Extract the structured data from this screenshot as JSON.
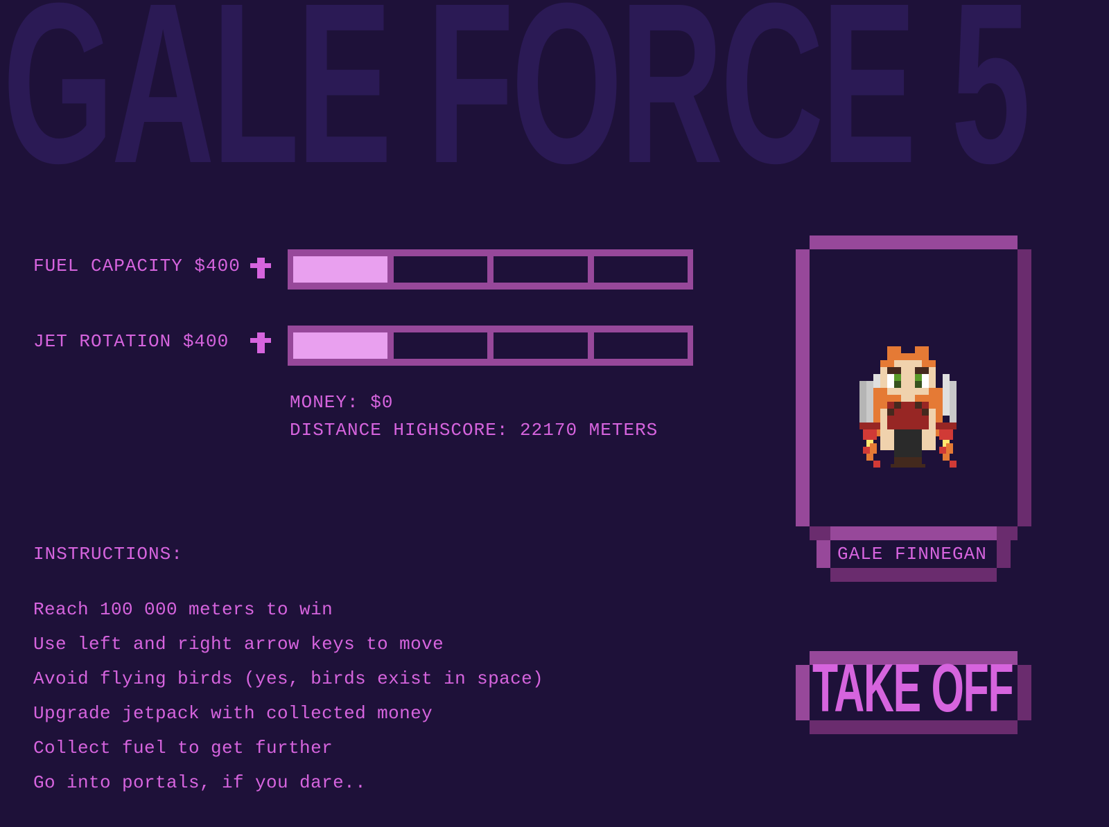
{
  "game": {
    "title": "GALE FORCE 5"
  },
  "colors": {
    "background": "#1e1139",
    "title_text": "#2b1a55",
    "text": "#d664de",
    "frame_light": "#97489a",
    "frame_dark": "#6a2c6e",
    "bar_filled": "#e9a0ef"
  },
  "upgrades": [
    {
      "label": "FUEL CAPACITY $400",
      "icon": "plus-icon",
      "level": 1,
      "max_level": 4
    },
    {
      "label": "JET ROTATION $400",
      "icon": "plus-icon",
      "level": 1,
      "max_level": 4
    }
  ],
  "stats": {
    "money": "MONEY: $0",
    "highscore": "DISTANCE HIGHSCORE: 22170 METERS"
  },
  "instructions": {
    "title": "INSTRUCTIONS:",
    "items": [
      "Reach 100 000 meters to win",
      "Use left and right arrow keys to move",
      "Avoid flying birds (yes, birds exist in space)",
      "Upgrade jetpack with collected money",
      "Collect fuel to get further",
      "Go into portals, if you dare.."
    ]
  },
  "character": {
    "name": "GALE FINNEGAN",
    "sprite": "jetpack-pilot-sprite"
  },
  "takeoff_button": {
    "label": "TAKE OFF"
  }
}
